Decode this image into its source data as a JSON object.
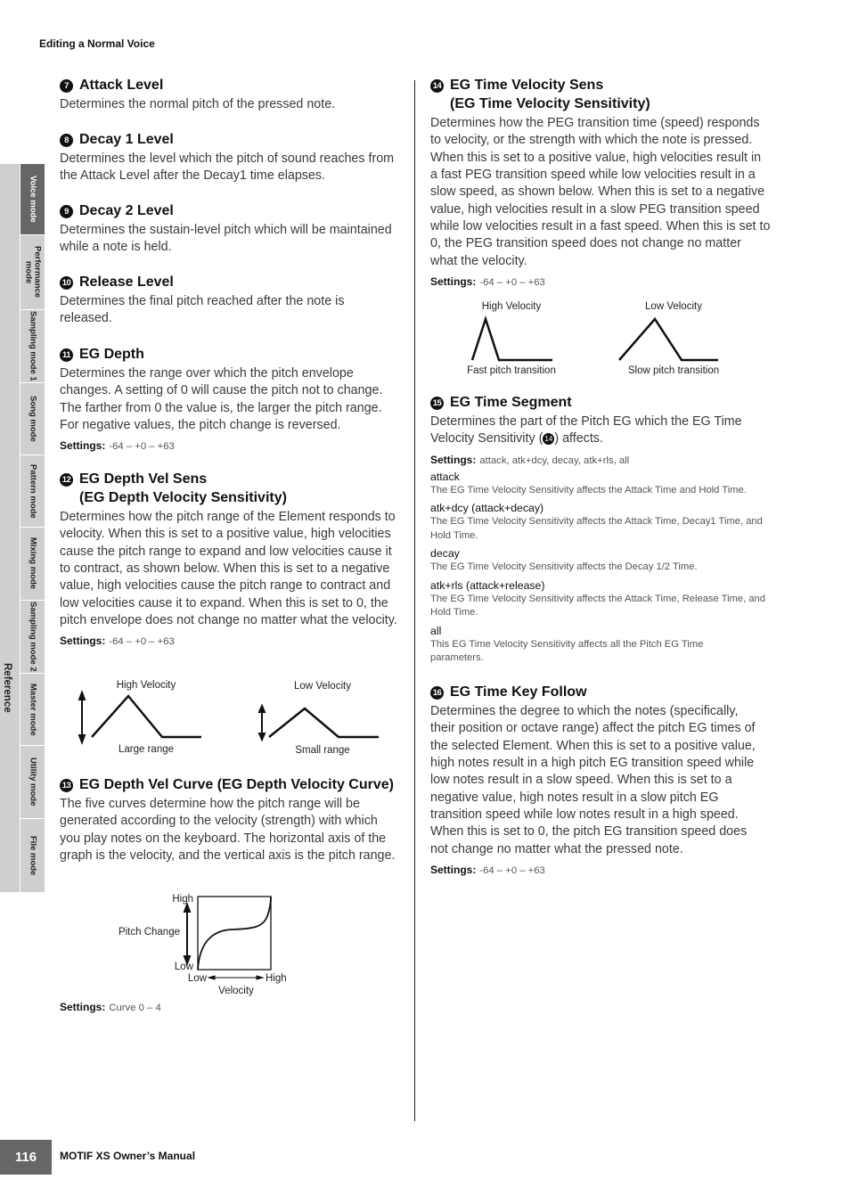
{
  "running_header": "Editing a Normal Voice",
  "sidebar": {
    "section_label": "Reference",
    "tabs": [
      {
        "label": "Voice mode",
        "active": true
      },
      {
        "label": "Performance mode",
        "active": false
      },
      {
        "label": "Sampling mode 1",
        "active": false
      },
      {
        "label": "Song mode",
        "active": false
      },
      {
        "label": "Pattern mode",
        "active": false
      },
      {
        "label": "Mixing mode",
        "active": false
      },
      {
        "label": "Sampling mode 2",
        "active": false
      },
      {
        "label": "Master mode",
        "active": false
      },
      {
        "label": "Utility mode",
        "active": false
      },
      {
        "label": "File mode",
        "active": false
      }
    ]
  },
  "sections": {
    "attack_level": {
      "num": "7",
      "title": "Attack Level",
      "body": "Determines the normal pitch of the pressed note."
    },
    "decay1_level": {
      "num": "8",
      "title": "Decay 1 Level",
      "body": "Determines the level which the pitch of sound reaches from the Attack Level after the Decay1 time elapses."
    },
    "decay2_level": {
      "num": "9",
      "title": "Decay 2 Level",
      "body": "Determines the sustain-level pitch which will be maintained while a note is held."
    },
    "release_level": {
      "num": "10",
      "title": "Release Level",
      "body": "Determines the final pitch reached after the note is released."
    },
    "eg_depth": {
      "num": "11",
      "title": "EG Depth",
      "body": "Determines the range over which the pitch envelope changes. A setting of 0 will cause the pitch not to change. The farther from 0 the value is, the larger the pitch range. For negative values, the pitch change is reversed.",
      "settings_label": "Settings:",
      "settings": "-64 – +0 – +63"
    },
    "eg_depth_vel_sens": {
      "num": "12",
      "title": "EG Depth Vel Sens",
      "subtitle": "(EG Depth Velocity Sensitivity)",
      "body": "Determines how the pitch range of the Element responds to velocity. When this is set to a positive value, high velocities cause the pitch range to expand and low velocities cause it to contract, as shown below. When this is set to a negative value, high velocities cause the pitch range to contract and low velocities cause it to expand. When this is set to 0, the pitch envelope does not change no matter what the velocity.",
      "settings_label": "Settings:",
      "settings": "-64 – +0 – +63",
      "diagram": {
        "left_title": "High Velocity",
        "left_caption": "Large range",
        "right_title": "Low Velocity",
        "right_caption": "Small range"
      }
    },
    "eg_depth_vel_curve": {
      "num": "13",
      "title": "EG Depth Vel Curve (EG Depth Velocity Curve)",
      "body": "The five curves determine how the pitch range will be generated according to the velocity (strength) with which you play notes on the keyboard. The horizontal axis of the graph is the velocity, and the vertical axis is the pitch range.",
      "settings_label": "Settings:",
      "settings": "Curve 0 – 4",
      "graph": {
        "y_label": "Pitch Change",
        "y_high": "High",
        "y_low": "Low",
        "x_label": "Velocity",
        "x_low": "Low",
        "x_high": "High"
      }
    },
    "eg_time_vel_sens": {
      "num": "14",
      "title": "EG Time Velocity Sens",
      "subtitle": "(EG Time Velocity Sensitivity)",
      "body": "Determines how the PEG transition time (speed) responds to velocity, or the strength with which the note is pressed. When this is set to a positive value, high velocities result in a fast PEG transition speed while low velocities result in a slow speed, as shown below. When this is set to a negative value, high velocities result in a slow PEG transition speed while low velocities result in a fast speed. When this is set to 0, the PEG transition speed does not change no matter what the velocity.",
      "settings_label": "Settings:",
      "settings": "-64 – +0 – +63",
      "diagram": {
        "left_title": "High Velocity",
        "left_caption": "Fast pitch transition",
        "right_title": "Low Velocity",
        "right_caption": "Slow pitch transition"
      }
    },
    "eg_time_segment": {
      "num": "15",
      "title": "EG Time Segment",
      "body_before": "Determines the part of the Pitch EG which the EG Time Velocity Sensitivity (",
      "body_ref": "14",
      "body_after": ") affects.",
      "settings_label": "Settings:",
      "settings": "attack, atk+dcy, decay, atk+rls, all",
      "options": [
        {
          "name": "attack",
          "desc": "The EG Time Velocity Sensitivity affects the Attack Time and Hold Time."
        },
        {
          "name": "atk+dcy (attack+decay)",
          "desc": "The EG Time Velocity Sensitivity affects the Attack Time, Decay1 Time, and Hold Time."
        },
        {
          "name": "decay",
          "desc": "The EG Time Velocity Sensitivity affects the Decay 1/2 Time."
        },
        {
          "name": "atk+rls (attack+release)",
          "desc": "The EG Time Velocity Sensitivity affects the Attack Time, Release Time, and Hold Time."
        },
        {
          "name": "all",
          "desc": "This EG Time Velocity Sensitivity affects all the Pitch EG Time parameters."
        }
      ]
    },
    "eg_time_key_follow": {
      "num": "16",
      "title": "EG Time Key Follow",
      "body": "Determines the degree to which the notes (specifically, their position or octave range) affect the pitch EG times of the selected Element. When this is set to a positive value, high notes result in a high pitch EG transition speed while low notes result in a slow speed. When this is set to a negative value, high notes result in a slow pitch EG transition speed while low notes result in a high speed. When this is set to 0, the pitch EG transition speed does not change no matter what the pressed note.",
      "settings_label": "Settings:",
      "settings": "-64 – +0 – +63"
    }
  },
  "footer": {
    "page_number": "116",
    "manual_title": "MOTIF XS Owner’s Manual"
  }
}
